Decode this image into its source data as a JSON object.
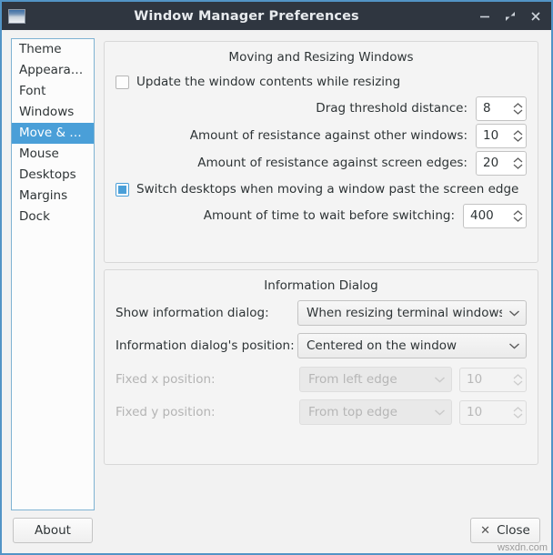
{
  "window": {
    "title": "Window Manager Preferences",
    "icon": "window-icon",
    "controls": {
      "minimize": "minimize-icon",
      "maximize": "maximize-icon",
      "close": "close-icon"
    }
  },
  "sidebar": {
    "items": [
      {
        "label": "Theme",
        "selected": false
      },
      {
        "label": "Appeara…",
        "selected": false
      },
      {
        "label": "Font",
        "selected": false
      },
      {
        "label": "Windows",
        "selected": false
      },
      {
        "label": "Move & …",
        "selected": true
      },
      {
        "label": "Mouse",
        "selected": false
      },
      {
        "label": "Desktops",
        "selected": false
      },
      {
        "label": "Margins",
        "selected": false
      },
      {
        "label": "Dock",
        "selected": false
      }
    ]
  },
  "moving_section": {
    "title": "Moving and Resizing Windows",
    "update_contents": {
      "label": "Update the window contents while resizing",
      "checked": false
    },
    "drag_threshold": {
      "label": "Drag threshold distance:",
      "value": "8"
    },
    "resistance_windows": {
      "label": "Amount of resistance against other windows:",
      "value": "10"
    },
    "resistance_edges": {
      "label": "Amount of resistance against screen edges:",
      "value": "20"
    },
    "switch_desktops": {
      "label": "Switch desktops when moving a window past the screen edge",
      "checked": true
    },
    "wait_time": {
      "label": "Amount of time to wait before switching:",
      "value": "400"
    }
  },
  "info_section": {
    "title": "Information Dialog",
    "show_dialog": {
      "label": "Show information dialog:",
      "value": "When resizing terminal windows"
    },
    "dialog_position": {
      "label": "Information dialog's position:",
      "value": "Centered on the window"
    },
    "fixed_x": {
      "label": "Fixed x position:",
      "mode": "From left edge",
      "value": "10",
      "enabled": false
    },
    "fixed_y": {
      "label": "Fixed y position:",
      "mode": "From top edge",
      "value": "10",
      "enabled": false
    }
  },
  "footer": {
    "about_label": "About",
    "close_label": "Close",
    "close_icon": "close-x-icon"
  },
  "watermark": "wsxdn.com",
  "colors": {
    "titlebar_bg": "#2f3640",
    "selection_blue": "#4a9fd8",
    "window_border": "#5294c6"
  }
}
